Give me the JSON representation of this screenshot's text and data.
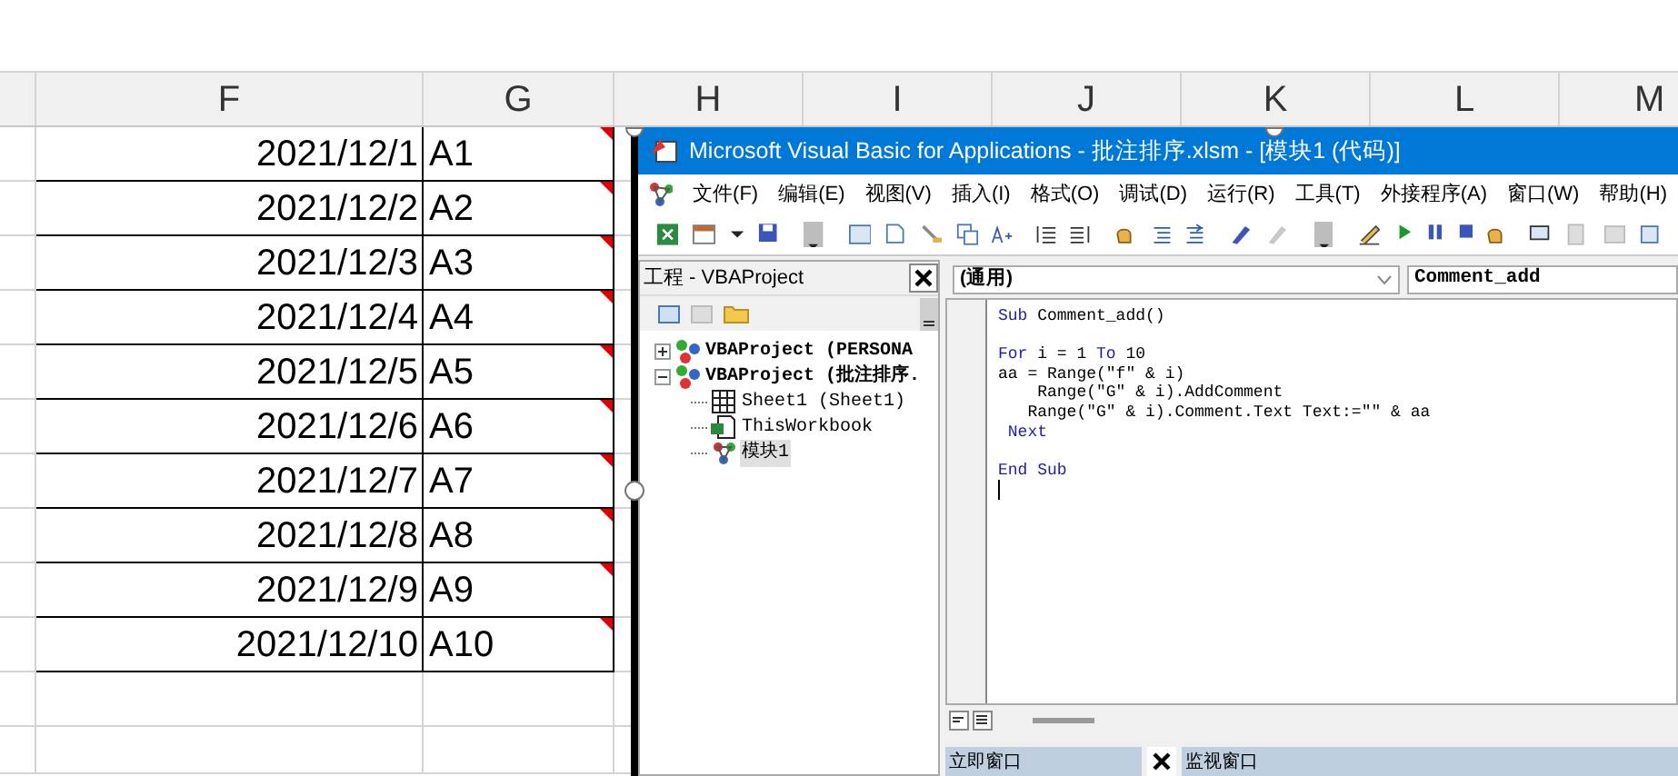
{
  "sheet": {
    "columns": [
      "F",
      "G",
      "H",
      "I",
      "J",
      "K",
      "L",
      "M"
    ],
    "rows": [
      {
        "date": "2021/12/1",
        "label": "A1",
        "has_comment": true
      },
      {
        "date": "2021/12/2",
        "label": "A2",
        "has_comment": true
      },
      {
        "date": "2021/12/3",
        "label": "A3",
        "has_comment": true
      },
      {
        "date": "2021/12/4",
        "label": "A4",
        "has_comment": true
      },
      {
        "date": "2021/12/5",
        "label": "A5",
        "has_comment": true
      },
      {
        "date": "2021/12/6",
        "label": "A6",
        "has_comment": true
      },
      {
        "date": "2021/12/7",
        "label": "A7",
        "has_comment": true
      },
      {
        "date": "2021/12/8",
        "label": "A8",
        "has_comment": true
      },
      {
        "date": "2021/12/9",
        "label": "A9",
        "has_comment": true
      },
      {
        "date": "2021/12/10",
        "label": "A10",
        "has_comment": true
      }
    ]
  },
  "vba": {
    "title": "Microsoft Visual Basic for Applications - 批注排序.xlsm - [模块1 (代码)]",
    "menu": [
      "文件(F)",
      "编辑(E)",
      "视图(V)",
      "插入(I)",
      "格式(O)",
      "调试(D)",
      "运行(R)",
      "工具(T)",
      "外接程序(A)",
      "窗口(W)",
      "帮助(H)"
    ],
    "project": {
      "title": "工程 - VBAProject",
      "tree": [
        {
          "label": "VBAProject (PERSONA",
          "kind": "project",
          "expanded": false,
          "selected": false
        },
        {
          "label": "VBAProject (批注排序.",
          "kind": "project",
          "expanded": true,
          "selected": false,
          "children": [
            {
              "label": "Sheet1 (Sheet1)",
              "kind": "sheet",
              "selected": false
            },
            {
              "label": "ThisWorkbook",
              "kind": "workbook",
              "selected": false
            },
            {
              "label": "模块1",
              "kind": "module",
              "selected": true
            }
          ]
        }
      ]
    },
    "code": {
      "object": "(通用)",
      "procedure": "Comment_add",
      "lines": [
        {
          "kind": "code",
          "tokens": [
            {
              "t": "Sub",
              "keyword": true
            },
            {
              "t": " Comment_add()",
              "keyword": false
            }
          ]
        },
        {
          "kind": "blank"
        },
        {
          "kind": "code",
          "tokens": [
            {
              "t": "For",
              "keyword": true
            },
            {
              "t": " i = 1 ",
              "keyword": false
            },
            {
              "t": "To",
              "keyword": true
            },
            {
              "t": " 10",
              "keyword": false
            }
          ]
        },
        {
          "kind": "code",
          "tokens": [
            {
              "t": "aa = Range(\"f\" & i)",
              "keyword": false
            }
          ]
        },
        {
          "kind": "code",
          "tokens": [
            {
              "t": "    Range(\"G\" & i).AddComment",
              "keyword": false
            }
          ]
        },
        {
          "kind": "code",
          "tokens": [
            {
              "t": "   Range(\"G\" & i).Comment.Text Text:=\"\" & aa",
              "keyword": false
            }
          ]
        },
        {
          "kind": "code",
          "tokens": [
            {
              "t": " Next",
              "keyword": true
            }
          ]
        },
        {
          "kind": "blank"
        },
        {
          "kind": "code",
          "tokens": [
            {
              "t": "End Sub",
              "keyword": true
            }
          ]
        },
        {
          "kind": "cursor"
        }
      ]
    },
    "panes": [
      {
        "title": "立即窗口"
      },
      {
        "title": "监视窗口"
      }
    ]
  }
}
